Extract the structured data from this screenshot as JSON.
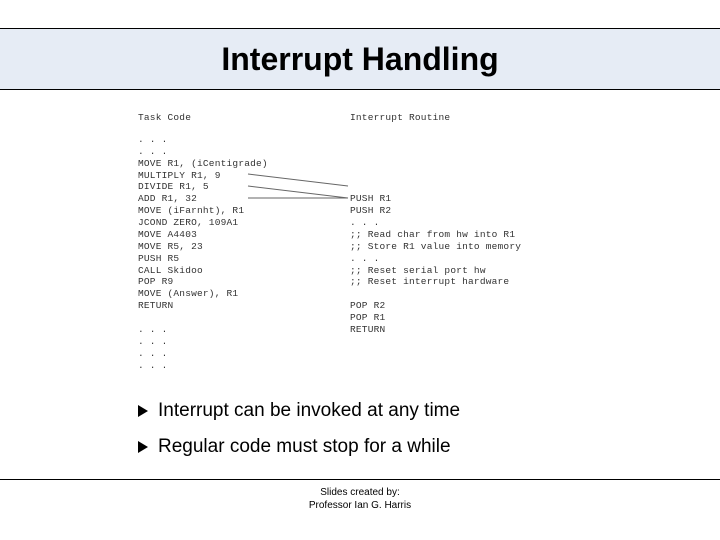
{
  "title": "Interrupt Handling",
  "code": {
    "left_header": "Task Code",
    "right_header": "Interrupt Routine",
    "left_lines": ". . .\n. . .\nMOVE R1, (iCentigrade)\nMULTIPLY R1, 9\nDIVIDE R1, 5\nADD R1, 32\nMOVE (iFarnht), R1\nJCOND ZERO, 109A1\nMOVE A4403\nMOVE R5, 23\nPUSH R5\nCALL Skidoo\nPOP R9\nMOVE (Answer), R1\nRETURN\n\n. . .\n. . .\n. . .\n. . .",
    "right_lines": "\n\n\n\n\nPUSH R1\nPUSH R2\n. . .\n;; Read char from hw into R1\n;; Store R1 value into memory\n. . .\n;; Reset serial port hw\n;; Reset interrupt hardware\n\nPOP R2\nPOP R1\nRETURN"
  },
  "bullets": [
    "Interrupt can be invoked at any time",
    "Regular code must stop for a while"
  ],
  "footer": {
    "line1": "Slides created by:",
    "line2": "Professor Ian G. Harris"
  }
}
